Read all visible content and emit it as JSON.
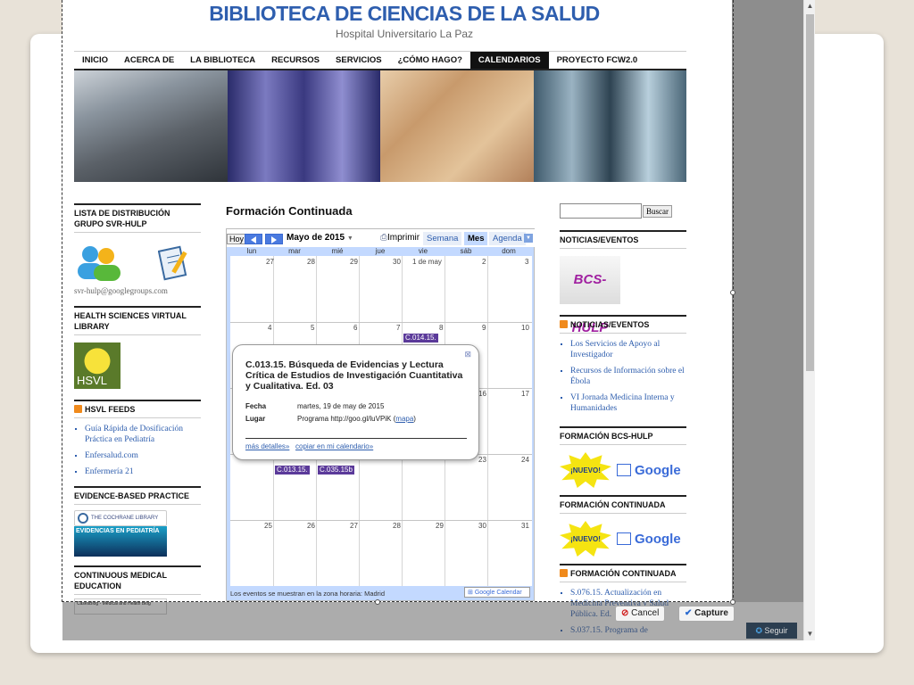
{
  "site": {
    "title": "BIBLIOTECA DE CIENCIAS DE LA SALUD",
    "subtitle": "Hospital Universitario La Paz"
  },
  "nav": [
    "INICIO",
    "ACERCA DE",
    "LA BIBLIOTECA",
    "RECURSOS",
    "SERVICIOS",
    "¿CÓMO HAGO?",
    "CALENDARIOS",
    "PROYECTO FCW2.0"
  ],
  "left": {
    "list_title": "LISTA DE DISTRIBUCIÓN GRUPO SVR-HULP",
    "email": "svr-hulp@googlegroups.com",
    "hsvl_title": "HEALTH SCIENCES VIRTUAL LIBRARY",
    "hsvl_logo": "HSVL",
    "feeds_title": "HSVL FEEDS",
    "feeds": [
      "Guía Rápida de Dosificación Práctica en Pediatría",
      "Enfersalud.com",
      "Enfermería 21"
    ],
    "ebp_title": "EVIDENCE-BASED PRACTICE",
    "cochrane": "THE COCHRANE LIBRARY",
    "evidencias": "EVIDENCIAS EN PEDIATRÍA",
    "cme_title": "CONTINUOUS MEDICAL EDUCATION",
    "caseblog": "CasesBlog - Medical and Health Blog"
  },
  "main": {
    "title": "Formación Continuada",
    "today": "Hoy",
    "month": "Mayo de 2015",
    "print": "Imprimir",
    "views": [
      "Semana",
      "Mes",
      "Agenda"
    ],
    "days": [
      "lun",
      "mar",
      "mié",
      "jue",
      "vie",
      "sáb",
      "dom"
    ],
    "weeks": [
      [
        "27",
        "28",
        "29",
        "30",
        "1 de may",
        "2",
        "3"
      ],
      [
        "4",
        "5",
        "6",
        "7",
        "8",
        "9",
        "10"
      ],
      [
        "",
        "",
        "",
        "",
        "",
        "16",
        "17"
      ],
      [
        "",
        "",
        "",
        "",
        "",
        "23",
        "24"
      ],
      [
        "25",
        "26",
        "27",
        "28",
        "29",
        "30",
        "31"
      ]
    ],
    "events": {
      "e1": "C.014.15.",
      "e2": "C.013.15.",
      "e3": "C.035.15b"
    },
    "timezone": "Los eventos se muestran en la zona horaria: Madrid",
    "gcal_badge": "Google Calendar",
    "popup": {
      "title": "C.013.15. Búsqueda de Evidencias y Lectura Crítica de Estudios de Investigación Cuantitativa y Cualitativa. Ed. 03",
      "fecha_label": "Fecha",
      "fecha": "martes, 19 de may de 2015",
      "lugar_label": "Lugar",
      "lugar": "Programa http://goo.gl/luVPiK (",
      "mapa": "mapa",
      "lugar_end": ")",
      "more": "más detalles»",
      "copy": "copiar en mi calendario»"
    }
  },
  "right": {
    "search_button": "Buscar",
    "news_title": "NOTICIAS/EVENTOS",
    "bcs_logo": "BCS-HULP",
    "news2_title": "NOTICIAS/EVENTOS",
    "news": [
      "Los Servicios de Apoyo al Investigador",
      "Recursos de Información sobre el Ébola",
      "VI Jornada Medicina Interna y Humanidades"
    ],
    "bcs_title": "FORMACIÓN BCS-HULP",
    "nuevo": "¡NUEVO!",
    "google": "Google",
    "fc_title": "FORMACIÓN CONTINUADA",
    "fc2_title": "FORMACIÓN CONTINUADA",
    "fc_items": [
      "S.076.15. Actualización en Medicina Preventiva y Salud Pública. Ed.",
      "S.037.15. Programa de"
    ]
  },
  "capture": {
    "cancel": "Cancel",
    "capture": "Capture"
  },
  "follow": "Seguir"
}
